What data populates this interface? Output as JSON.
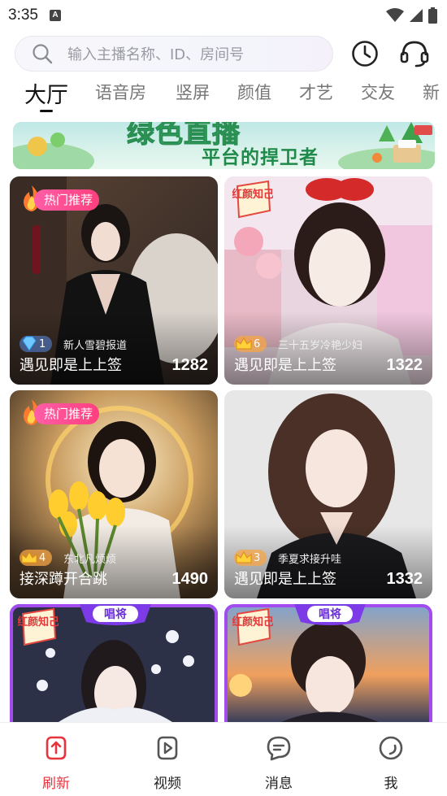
{
  "status_bar": {
    "time": "3:35",
    "notification_letter": "A"
  },
  "search": {
    "placeholder": "输入主播名称、ID、房间号"
  },
  "tabs": [
    {
      "label": "大厅",
      "active": true
    },
    {
      "label": "语音房"
    },
    {
      "label": "竖屏"
    },
    {
      "label": "颜值"
    },
    {
      "label": "才艺"
    },
    {
      "label": "交友"
    },
    {
      "label": "新"
    }
  ],
  "banner": {
    "title": "绿色直播",
    "subtitle": "平台的捍卫者"
  },
  "cards": [
    {
      "badge": "热门推荐",
      "level": "1",
      "level_type": "diamond",
      "nickname": "新人雪碧报道",
      "title": "遇见即是上上签",
      "count": "1282"
    },
    {
      "badge": "红颜知己",
      "level": "6",
      "level_type": "crown",
      "nickname": "三十五岁冷艳少妇",
      "title": "遇见即是上上签",
      "count": "1322"
    },
    {
      "badge": "热门推荐",
      "level": "4",
      "level_type": "crown",
      "nickname": "东北凡烦烦",
      "title": "接深蹲开合跳",
      "count": "1490"
    },
    {
      "badge": "",
      "level": "3",
      "level_type": "crown",
      "nickname": "季夏求接升哇",
      "title": "遇见即是上上签",
      "count": "1332"
    },
    {
      "badge": "红颜知己",
      "badge2": "唱将"
    },
    {
      "badge": "红颜知己",
      "badge2": "唱将"
    }
  ],
  "bottom_nav": [
    {
      "label": "刷新",
      "icon": "refresh-up-icon",
      "active": true
    },
    {
      "label": "视频",
      "icon": "video-play-icon"
    },
    {
      "label": "消息",
      "icon": "message-icon"
    },
    {
      "label": "我",
      "icon": "profile-icon"
    }
  ],
  "colors": {
    "accent": "#e8333d",
    "hot_badge": "#ff4f8f",
    "frame": "#a24cf0"
  }
}
